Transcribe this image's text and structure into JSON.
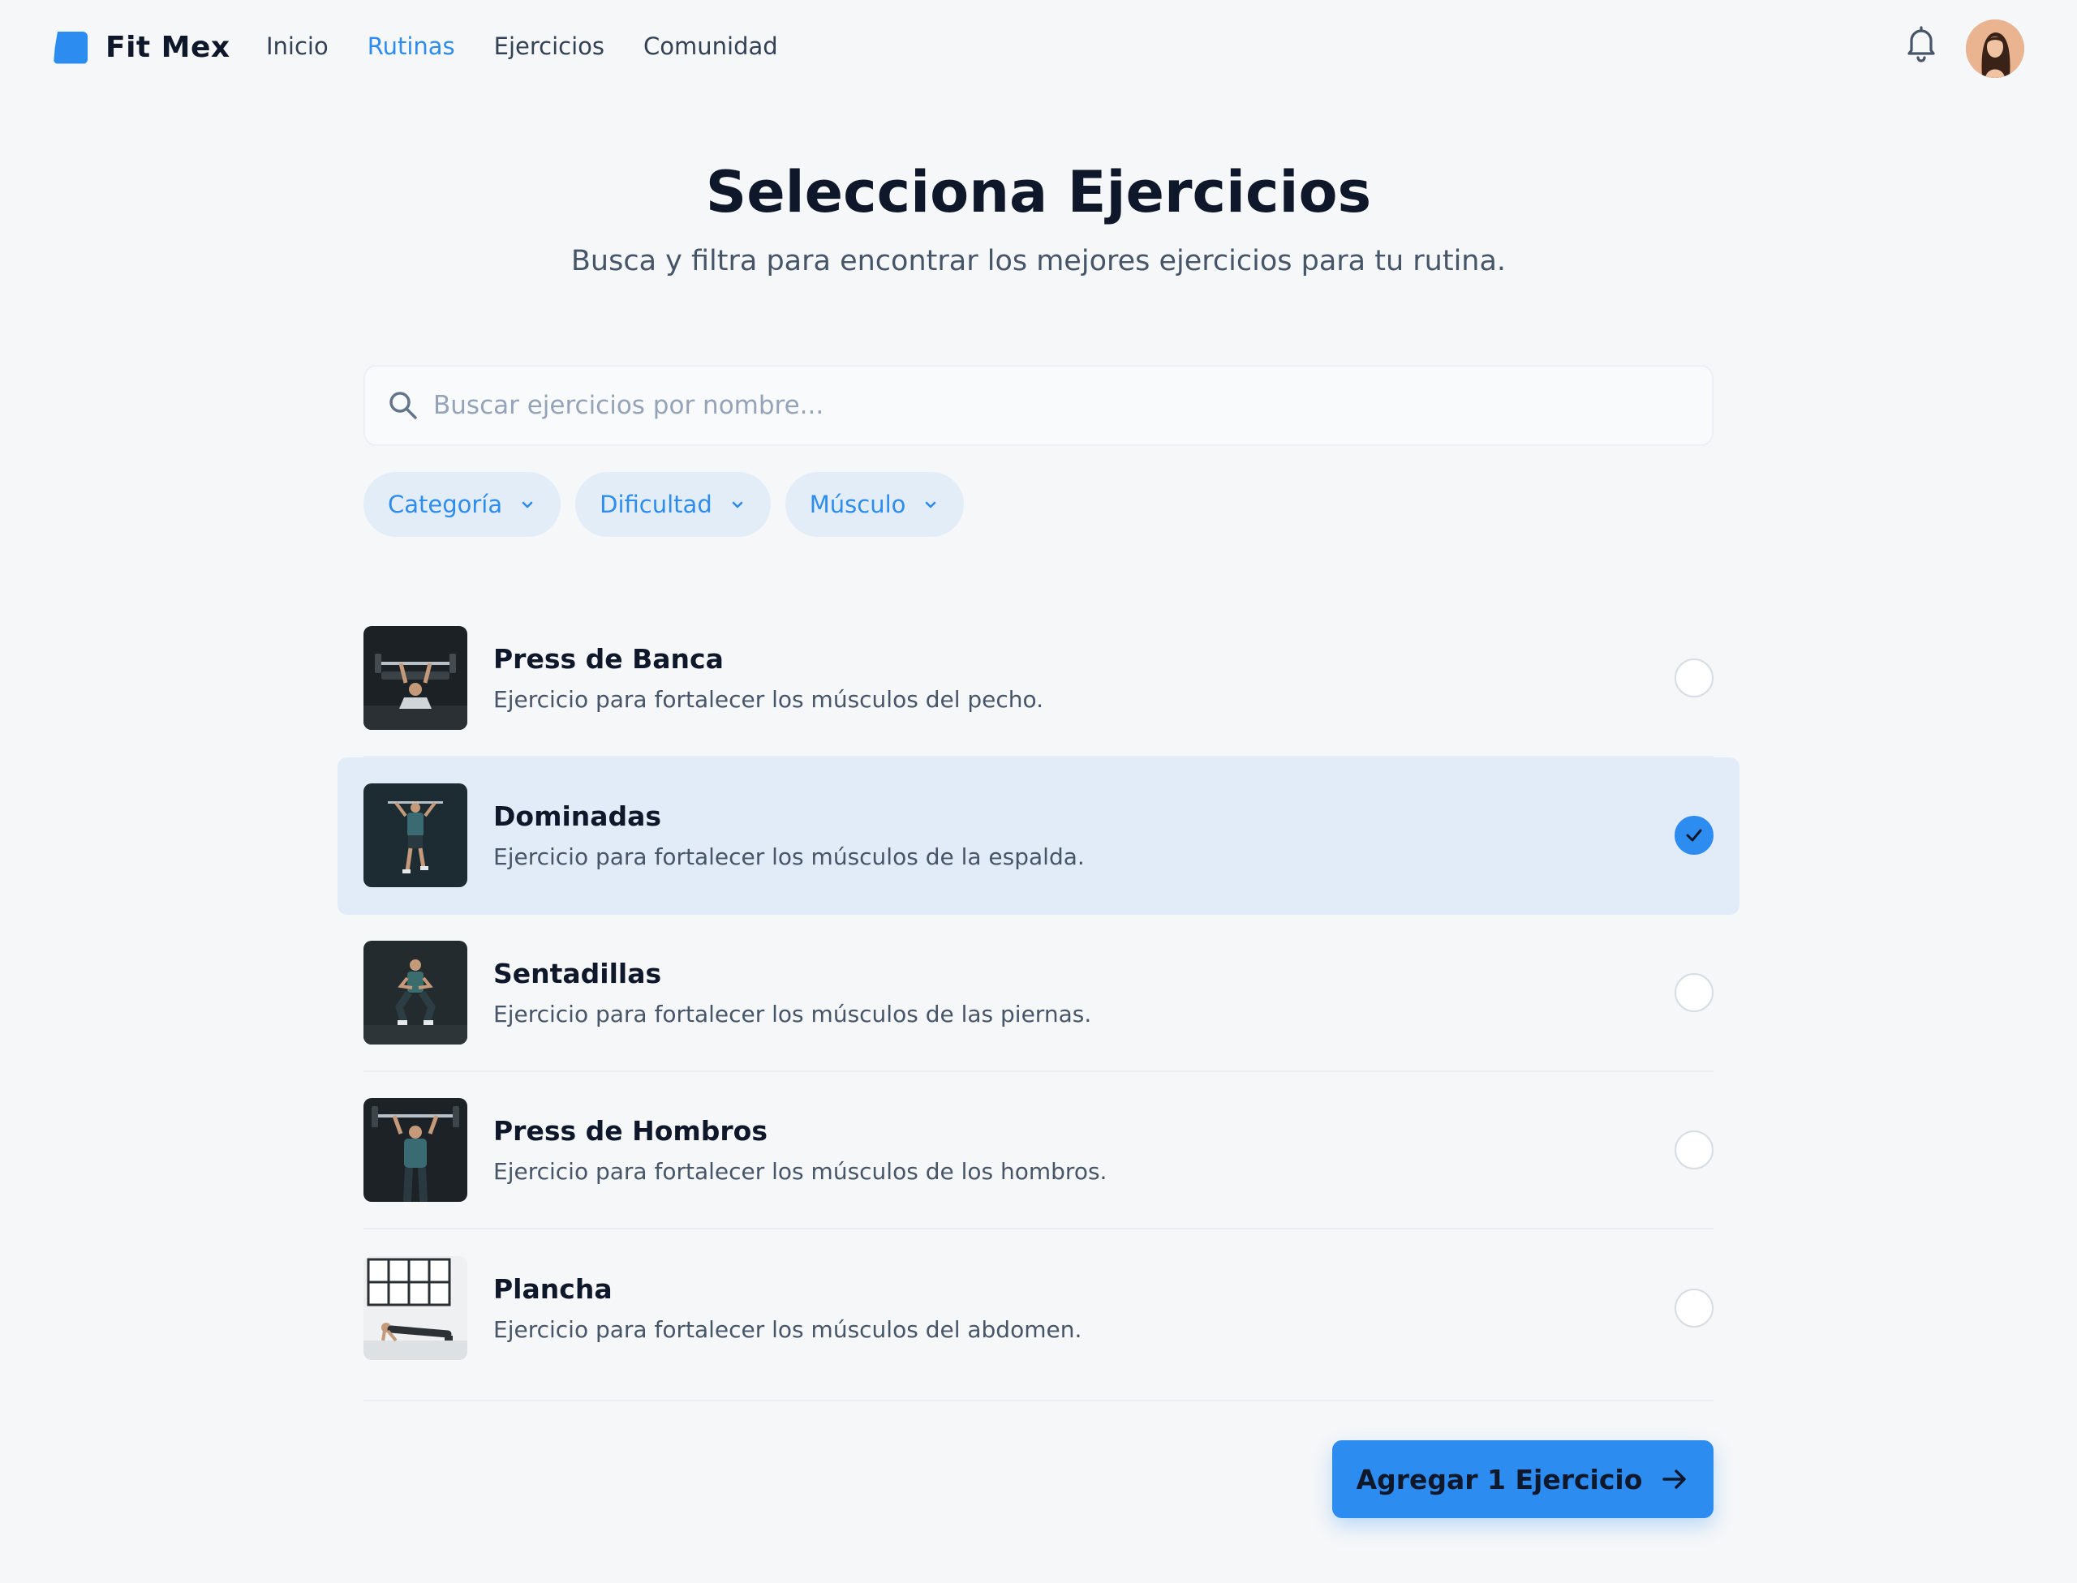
{
  "app": {
    "name": "Fit Mex"
  },
  "nav": {
    "items": [
      {
        "label": "Inicio",
        "active": false
      },
      {
        "label": "Rutinas",
        "active": true
      },
      {
        "label": "Ejercicios",
        "active": false
      },
      {
        "label": "Comunidad",
        "active": false
      }
    ]
  },
  "header": {
    "icons": [
      "bell-icon",
      "avatar"
    ]
  },
  "hero": {
    "title": "Selecciona Ejercicios",
    "subtitle": "Busca y filtra para encontrar los mejores ejercicios para tu rutina."
  },
  "search": {
    "placeholder": "Buscar ejercicios por nombre...",
    "value": ""
  },
  "filters": [
    {
      "label": "Categoría"
    },
    {
      "label": "Dificultad"
    },
    {
      "label": "Músculo"
    }
  ],
  "exercises": [
    {
      "name": "Press de Banca",
      "description": "Ejercicio para fortalecer los músculos del pecho.",
      "selected": false
    },
    {
      "name": "Dominadas",
      "description": "Ejercicio para fortalecer los músculos de la espalda.",
      "selected": true
    },
    {
      "name": "Sentadillas",
      "description": "Ejercicio para fortalecer los músculos de las piernas.",
      "selected": false
    },
    {
      "name": "Press de Hombros",
      "description": "Ejercicio para fortalecer los músculos de los hombros.",
      "selected": false
    },
    {
      "name": "Plancha",
      "description": "Ejercicio para fortalecer los músculos del abdomen.",
      "selected": false
    }
  ],
  "cta": {
    "label": "Agregar 1 Ejercicio"
  },
  "colors": {
    "accent": "#2d8cf0",
    "background": "#f5f7f9",
    "selected_row": "#e1ecf8",
    "chip_bg": "#e3edf7"
  }
}
